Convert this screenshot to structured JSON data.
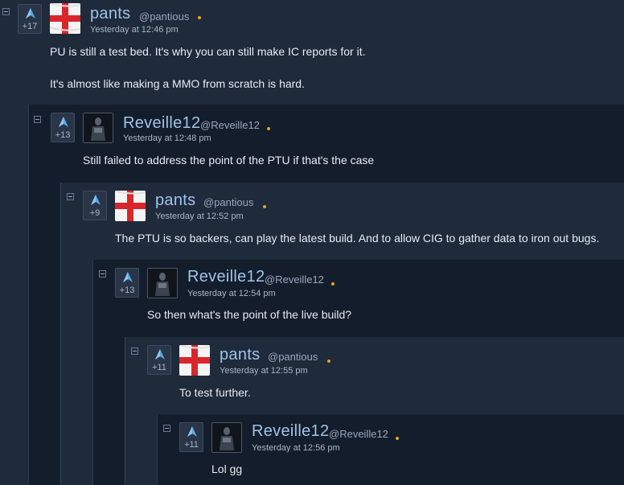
{
  "comments": [
    {
      "score": "+17",
      "username": "pants",
      "handle": "@pantious",
      "time": "Yesterday at 12:46 pm",
      "avatar": "england-flag-avatar",
      "body": [
        "PU is still a test bed. It's why you can still make IC reports for it.",
        "It's almost like making a MMO from scratch is hard."
      ]
    },
    {
      "score": "+13",
      "username": "Reveille12",
      "handle": "@Reveille12",
      "time": "Yesterday at 12:48 pm",
      "avatar": "soldier-avatar",
      "body": [
        "Still failed to address the point of the PTU if that's the case"
      ]
    },
    {
      "score": "+9",
      "username": "pants",
      "handle": "@pantious",
      "time": "Yesterday at 12:52 pm",
      "avatar": "england-flag-avatar",
      "body": [
        "The PTU is so backers, can play the latest build. And to allow CIG to gather data to iron out bugs."
      ]
    },
    {
      "score": "+13",
      "username": "Reveille12",
      "handle": "@Reveille12",
      "time": "Yesterday at 12:54 pm",
      "avatar": "soldier-avatar",
      "body": [
        "So then what's the point of the live build?"
      ]
    },
    {
      "score": "+11",
      "username": "pants",
      "handle": "@pantious",
      "time": "Yesterday at 12:55 pm",
      "avatar": "england-flag-avatar",
      "body": [
        "To test further."
      ]
    },
    {
      "score": "+11",
      "username": "Reveille12",
      "handle": "@Reveille12",
      "time": "Yesterday at 12:56 pm",
      "avatar": "soldier-avatar",
      "body": [
        "Lol gg"
      ]
    }
  ],
  "colors": {
    "username": "#9fc3ea",
    "online_dot": "#e8a317",
    "upvote_arrow": "#5aa9e6"
  }
}
